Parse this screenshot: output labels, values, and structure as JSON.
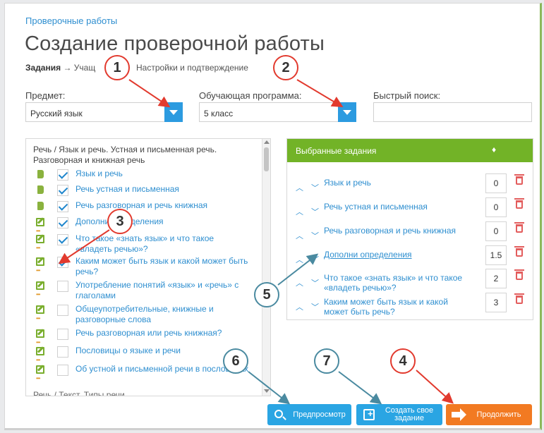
{
  "breadcrumb": "Проверочные работы",
  "title": "Создание проверочной работы",
  "steps": {
    "active": "Задания",
    "arrow": "→",
    "step2": "Учащ",
    "step3": "Настройки и подтверждение"
  },
  "filters": {
    "subject_label": "Предмет:",
    "subject_value": "Русский язык",
    "program_label": "Обучающая программа:",
    "program_value": "5 класс",
    "search_label": "Быстрый поиск:"
  },
  "task_list": {
    "section_title": "Речь / Язык и речь. Устная и письменная речь. Разговорная и книжная речь",
    "items": [
      {
        "label": "Язык и речь",
        "icon": "book-icon",
        "checked": true
      },
      {
        "label": "Речь устная и письменная",
        "icon": "book-icon",
        "checked": true
      },
      {
        "label": "Речь разговорная и речь книжная",
        "icon": "book-icon",
        "checked": true
      },
      {
        "label": "Дополни определения",
        "icon": "edit-icon",
        "checked": true
      },
      {
        "label": "Что такое «знать язык» и что такое «владеть речью»?",
        "icon": "edit-icon",
        "checked": true
      },
      {
        "label": "Каким может быть язык и какой может быть речь?",
        "icon": "edit-icon",
        "checked": true
      },
      {
        "label": "Употребление понятий «язык» и «речь» с глаголами",
        "icon": "edit-icon",
        "checked": false
      },
      {
        "label": "Общеупотребительные, книжные и разговорные слова",
        "icon": "edit-icon",
        "checked": false
      },
      {
        "label": "Речь разговорная или речь книжная?",
        "icon": "edit-icon",
        "checked": false
      },
      {
        "label": "Пословицы о языке и речи",
        "icon": "edit-icon",
        "checked": false
      },
      {
        "label": "Об устной и письменной речи в пословицах",
        "icon": "edit-icon",
        "checked": false
      }
    ],
    "next_section": "Речь / Текст. Типы речи"
  },
  "selected": {
    "header": "Выбранные задания",
    "points_header": "♦",
    "items": [
      {
        "label": "Язык и речь",
        "points": "0",
        "underline": false
      },
      {
        "label": "Речь устная и письменная",
        "points": "0",
        "underline": false
      },
      {
        "label": "Речь разговорная и речь книжная",
        "points": "0",
        "underline": false
      },
      {
        "label": "Дополни определения",
        "points": "1.5",
        "underline": true
      },
      {
        "label": "Что такое «знать язык» и что такое «владеть речью»?",
        "points": "2",
        "underline": false
      },
      {
        "label": "Каким может быть язык и какой может быть речь?",
        "points": "3",
        "underline": false
      }
    ]
  },
  "buttons": {
    "preview": "Предпросмотр",
    "create": "Создать свое задание",
    "continue": "Продолжить"
  },
  "callouts": [
    "1",
    "2",
    "3",
    "4",
    "5",
    "6",
    "7"
  ],
  "colors": {
    "accent_blue": "#2aa5e3",
    "header_green": "#72b327",
    "continue_orange": "#f27a22",
    "callout_red": "#e23a2e",
    "callout_teal": "#4a8aa0"
  }
}
